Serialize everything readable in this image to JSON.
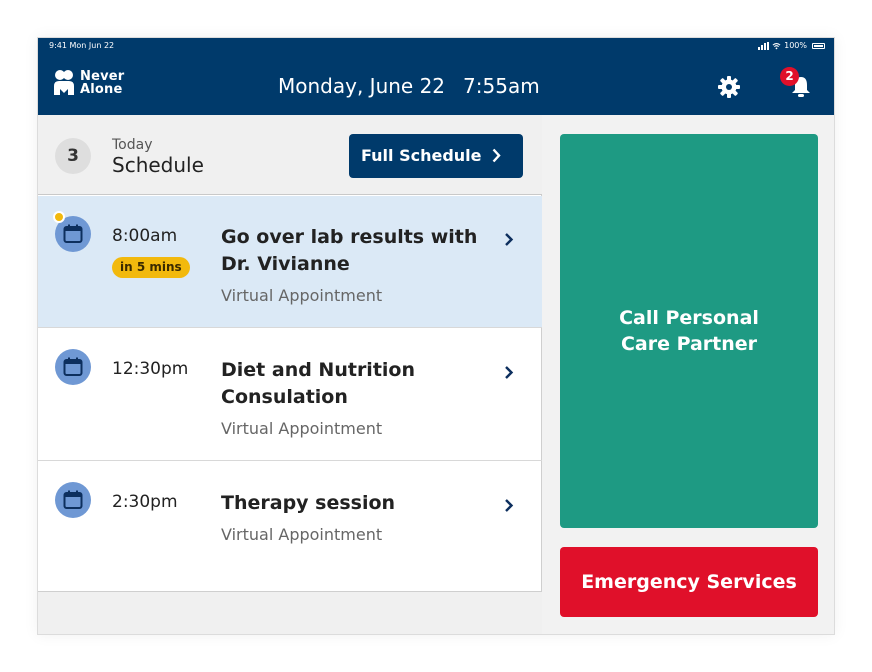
{
  "status_bar": {
    "time": "9:41 Mon Jun 22",
    "battery": "100%"
  },
  "header": {
    "logo_line1": "Never",
    "logo_line2": "Alone",
    "date": "Monday, June 22",
    "time": "7:55am",
    "notification_count": "2"
  },
  "schedule": {
    "count": "3",
    "today_label": "Today",
    "title": "Schedule",
    "full_schedule_label": "Full Schedule",
    "appointments": [
      {
        "time": "8:00am",
        "eta": "in 5 mins",
        "title": "Go over lab results with Dr. Vivianne",
        "type": "Virtual Appointment"
      },
      {
        "time": "12:30pm",
        "title": "Diet and Nutrition Consulation",
        "type": "Virtual Appointment"
      },
      {
        "time": "2:30pm",
        "title": "Therapy session",
        "type": "Virtual Appointment"
      }
    ]
  },
  "actions": {
    "call_line1": "Call Personal",
    "call_line2": "Care Partner",
    "emergency_label": "Emergency Services"
  },
  "colors": {
    "header_bg": "#003a6b",
    "active_row": "#dbe9f6",
    "eta_badge": "#f2b90d",
    "call_green": "#1e9a83",
    "emergency_red": "#e0102a",
    "calendar_icon": "#6f98d4"
  },
  "icons": [
    "people-logo-icon",
    "gear-icon",
    "bell-icon",
    "calendar-icon",
    "chevron-right-icon",
    "signal-icon",
    "wifi-icon",
    "battery-icon"
  ]
}
